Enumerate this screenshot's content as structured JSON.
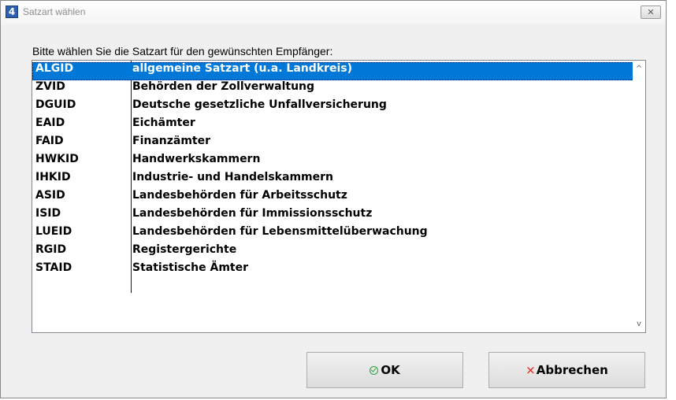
{
  "window": {
    "title": "Satzart wählen",
    "icon_label": "4",
    "close_label": "✕"
  },
  "prompt": "Bitte wählen Sie die Satzart für den gewünschten Empfänger:",
  "list": {
    "selected_index": 0,
    "rows": [
      {
        "code": "ALGID",
        "name": "allgemeine Satzart (u.a. Landkreis)"
      },
      {
        "code": "ZVID",
        "name": "Behörden der Zollverwaltung"
      },
      {
        "code": "DGUID",
        "name": "Deutsche gesetzliche Unfallversicherung"
      },
      {
        "code": "EAID",
        "name": "Eichämter"
      },
      {
        "code": "FAID",
        "name": "Finanzämter"
      },
      {
        "code": "HWKID",
        "name": "Handwerkskammern"
      },
      {
        "code": "IHKID",
        "name": "Industrie- und Handelskammern"
      },
      {
        "code": "ASID",
        "name": "Landesbehörden für Arbeitsschutz"
      },
      {
        "code": "ISID",
        "name": "Landesbehörden für Immissionsschutz"
      },
      {
        "code": "LUEID",
        "name": "Landesbehörden für Lebensmittelüberwachung"
      },
      {
        "code": "RGID",
        "name": "Registergerichte"
      },
      {
        "code": "STAID",
        "name": "Statistische Ämter"
      }
    ],
    "scroll_up": "^",
    "scroll_down": "v"
  },
  "buttons": {
    "ok_label": "OK",
    "cancel_label": "Abbrechen",
    "cancel_icon": "×"
  },
  "colors": {
    "selection": "#0078d7",
    "ok_icon": "#2aa43a",
    "cancel_icon": "#e02020"
  }
}
